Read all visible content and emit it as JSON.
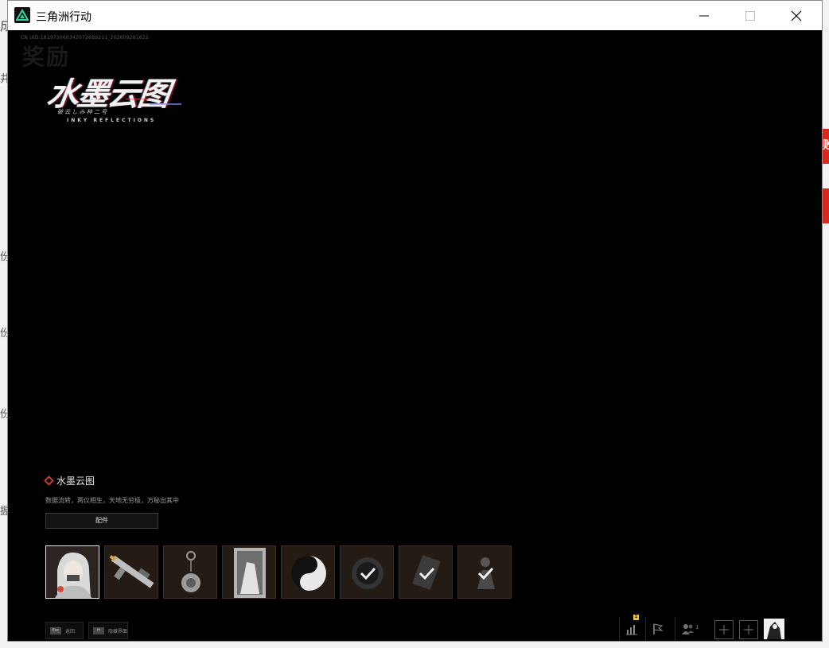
{
  "window": {
    "title": "三角洲行动",
    "controls": [
      "minimize",
      "maximize",
      "close"
    ]
  },
  "background_app": {
    "fragments": [
      "成",
      "井",
      "份",
      "份",
      "份",
      "握"
    ],
    "red_button_text": "败"
  },
  "game": {
    "uid_text": "CN UID:1819730603420726B9211_202609261622",
    "ghost_title": "奖励",
    "logo": {
      "main": "水墨云图",
      "sub_cn": "破 云 し み  种 二 号",
      "sub_en": "INKY REFLECTIONS"
    },
    "item": {
      "name": "水墨云图",
      "description": "数据流转，两仪相生，天地无穷极，万秘出其中",
      "parts_button": "配件"
    },
    "thumbnails": [
      {
        "name": "operator-skin",
        "selected": true
      },
      {
        "name": "rifle",
        "selected": false
      },
      {
        "name": "pendant",
        "selected": false
      },
      {
        "name": "card",
        "selected": false
      },
      {
        "name": "yin-yang-emblem",
        "selected": false
      },
      {
        "name": "watch",
        "selected": false
      },
      {
        "name": "device",
        "selected": false
      },
      {
        "name": "pose",
        "selected": false
      }
    ],
    "hints": [
      {
        "key": "Esc",
        "label": "返回"
      },
      {
        "key": "H",
        "label": "隐藏界面"
      }
    ],
    "bottom_right": {
      "stats_badge": "1",
      "friend_count": "1"
    }
  }
}
